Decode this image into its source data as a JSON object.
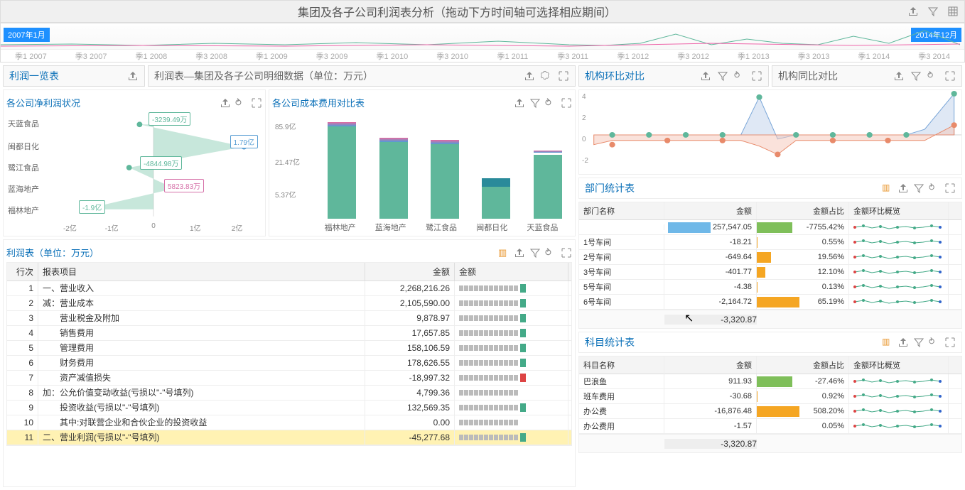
{
  "header": {
    "title": "集团及各子公司利润表分析（拖动下方时间轴可选择相应期间）"
  },
  "timeline": {
    "start_label": "2007年1月",
    "end_label": "2014年12月",
    "ticks": [
      "季1 2007",
      "季3 2007",
      "季1 2008",
      "季3 2008",
      "季1 2009",
      "季3 2009",
      "季1 2010",
      "季3 2010",
      "季1 2011",
      "季3 2011",
      "季1 2012",
      "季3 2012",
      "季1 2013",
      "季3 2013",
      "季1 2014",
      "季3 2014"
    ]
  },
  "left": {
    "overview_title": "利润一览表",
    "detail_title": "利润表—集团及各子公司明细数据（单位：万元）",
    "netprofit": {
      "title": "各公司净利润状况",
      "companies": [
        "天蓝食品",
        "闽都日化",
        "鹭江食品",
        "蓝海地产",
        "福林地产"
      ],
      "labels": {
        "v1": "-3239.49万",
        "v2": "1.79亿",
        "v3": "-4844.98万",
        "v4": "5823.83万",
        "v5": "-1.9亿"
      },
      "xticks": [
        "-2亿",
        "-1亿",
        "0",
        "1亿",
        "2亿"
      ]
    },
    "cost": {
      "title": "各公司成本费用对比表",
      "yticks": [
        "85.9亿",
        "21.47亿",
        "5.37亿"
      ],
      "companies": [
        "福林地产",
        "蓝海地产",
        "鹭江食品",
        "闽都日化",
        "天蓝食品"
      ]
    },
    "profit_table": {
      "title": "利润表（单位：万元）",
      "cols": [
        "行次",
        "报表项目",
        "金额",
        "金额"
      ],
      "rows": [
        {
          "idx": "1",
          "item": "一、营业收入",
          "amt": "2,268,216.26",
          "spark": "green"
        },
        {
          "idx": "2",
          "item": "减：营业成本",
          "amt": "2,105,590.00",
          "spark": "green"
        },
        {
          "idx": "3",
          "item": "　　营业税金及附加",
          "amt": "9,878.97",
          "spark": "green"
        },
        {
          "idx": "4",
          "item": "　　销售费用",
          "amt": "17,657.85",
          "spark": "green"
        },
        {
          "idx": "5",
          "item": "　　管理费用",
          "amt": "158,106.59",
          "spark": "green"
        },
        {
          "idx": "6",
          "item": "　　财务费用",
          "amt": "178,626.55",
          "spark": "green"
        },
        {
          "idx": "7",
          "item": "　　资产减值损失",
          "amt": "-18,997.32",
          "spark": "red"
        },
        {
          "idx": "8",
          "item": "加：公允价值变动收益(亏损以\"-\"号填列)",
          "amt": "4,799.36",
          "spark": "grey"
        },
        {
          "idx": "9",
          "item": "　　投资收益(亏损以\"-\"号填列)",
          "amt": "132,569.35",
          "spark": "green"
        },
        {
          "idx": "10",
          "item": "　　其中:对联营企业和合伙企业的投资收益",
          "amt": "0.00",
          "spark": "grey"
        },
        {
          "idx": "11",
          "item": "二、营业利润(亏损以\"-\"号填列)",
          "amt": "-45,277.68",
          "spark": "green",
          "sel": true
        }
      ]
    }
  },
  "right": {
    "compare_mom": "机构环比对比",
    "compare_yoy": "机构同比对比",
    "mc_yticks": [
      "4",
      "2",
      "0",
      "-2"
    ],
    "dept": {
      "title": "部门统计表",
      "cols": [
        "部门名称",
        "金额",
        "金额占比",
        "金额环比概览"
      ],
      "rows": [
        {
          "name": "",
          "amt": "257,547.05",
          "pct": "-7755.42%",
          "bar": "blue",
          "pctbar": "green"
        },
        {
          "name": "1号车间",
          "amt": "-18.21",
          "pct": "0.55%",
          "pctbar": "orange"
        },
        {
          "name": "2号车间",
          "amt": "-649.64",
          "pct": "19.56%",
          "pctbar": "orange"
        },
        {
          "name": "3号车间",
          "amt": "-401.77",
          "pct": "12.10%",
          "pctbar": "orange"
        },
        {
          "name": "5号车间",
          "amt": "-4.38",
          "pct": "0.13%",
          "pctbar": "orange"
        },
        {
          "name": "6号车间",
          "amt": "-2,164.72",
          "pct": "65.19%",
          "pctbar": "orange"
        }
      ],
      "total": "-3,320.87"
    },
    "subject": {
      "title": "科目统计表",
      "cols": [
        "科目名称",
        "金额",
        "金额占比",
        "金额环比概览"
      ],
      "rows": [
        {
          "name": "巴浪鱼",
          "amt": "911.93",
          "pct": "-27.46%",
          "pctbar": "green"
        },
        {
          "name": "班车费用",
          "amt": "-30.68",
          "pct": "0.92%",
          "pctbar": "orange"
        },
        {
          "name": "办公费",
          "amt": "-16,876.48",
          "pct": "508.20%",
          "pctbar": "orange"
        },
        {
          "name": "办公费用",
          "amt": "-1.57",
          "pct": "0.05%",
          "pctbar": "orange"
        }
      ],
      "total": "-3,320.87"
    }
  },
  "chart_data": [
    {
      "type": "bar",
      "title": "各公司净利润状况",
      "orientation": "horizontal",
      "categories": [
        "天蓝食品",
        "闽都日化",
        "鹭江食品",
        "蓝海地产",
        "福林地产"
      ],
      "values": [
        -3239.49,
        17900,
        -4844.98,
        5823.83,
        -19000
      ],
      "unit": "万",
      "xlim": [
        -20000,
        20000
      ]
    },
    {
      "type": "bar",
      "title": "各公司成本费用对比表",
      "categories": [
        "福林地产",
        "蓝海地产",
        "鹭江食品",
        "闽都日化",
        "天蓝食品"
      ],
      "values": [
        85.9,
        65,
        63,
        16,
        48
      ],
      "unit": "亿",
      "yscale": "log",
      "yticks": [
        5.37,
        21.47,
        85.9
      ]
    },
    {
      "type": "area",
      "title": "机构环比对比",
      "ylim": [
        -2,
        4
      ],
      "series": [
        {
          "name": "s1",
          "values": [
            0,
            0,
            0,
            0,
            0,
            0,
            0,
            0,
            0,
            4,
            -0.5,
            0,
            0,
            0,
            0,
            0,
            0,
            0,
            0.5,
            4
          ]
        },
        {
          "name": "s2",
          "values": [
            -0.8,
            -0.5,
            -0.5,
            -0.5,
            -0.5,
            -0.5,
            -0.5,
            -0.5,
            -0.5,
            -0.8,
            -1,
            -0.5,
            -0.5,
            -0.5,
            -0.5,
            -0.5,
            -0.5,
            -0.5,
            -0.5,
            1
          ]
        }
      ]
    }
  ]
}
